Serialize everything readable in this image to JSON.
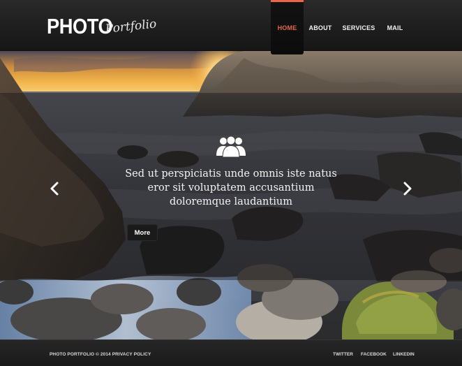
{
  "header": {
    "logo_main": "PHOTO",
    "logo_sub": "Portfolio",
    "nav": [
      {
        "label": "HOME",
        "active": true
      },
      {
        "label": "ABOUT",
        "active": false
      },
      {
        "label": "SERVICES",
        "active": false
      },
      {
        "label": "MAIL",
        "active": false
      }
    ]
  },
  "slider": {
    "icon": "users-group-icon",
    "text_lines": [
      "Sed ut perspiciatis unde omnis iste natus",
      "eror sit voluptatem accusantium",
      "doloremque laudantium"
    ],
    "more_label": "More",
    "prev_icon": "chevron-left-icon",
    "next_icon": "chevron-right-icon"
  },
  "footer": {
    "copyright": "PHOTO PORTFOLIO © 2014",
    "privacy_label": "PRIVACY POLICY",
    "social": [
      "TWITTER",
      "FACEBOOK",
      "LINKEDIN"
    ]
  },
  "colors": {
    "accent": "#e8654a",
    "header_bg": "#1e1e1e",
    "footer_bg": "#1f1f1f",
    "text": "#ffffff"
  }
}
